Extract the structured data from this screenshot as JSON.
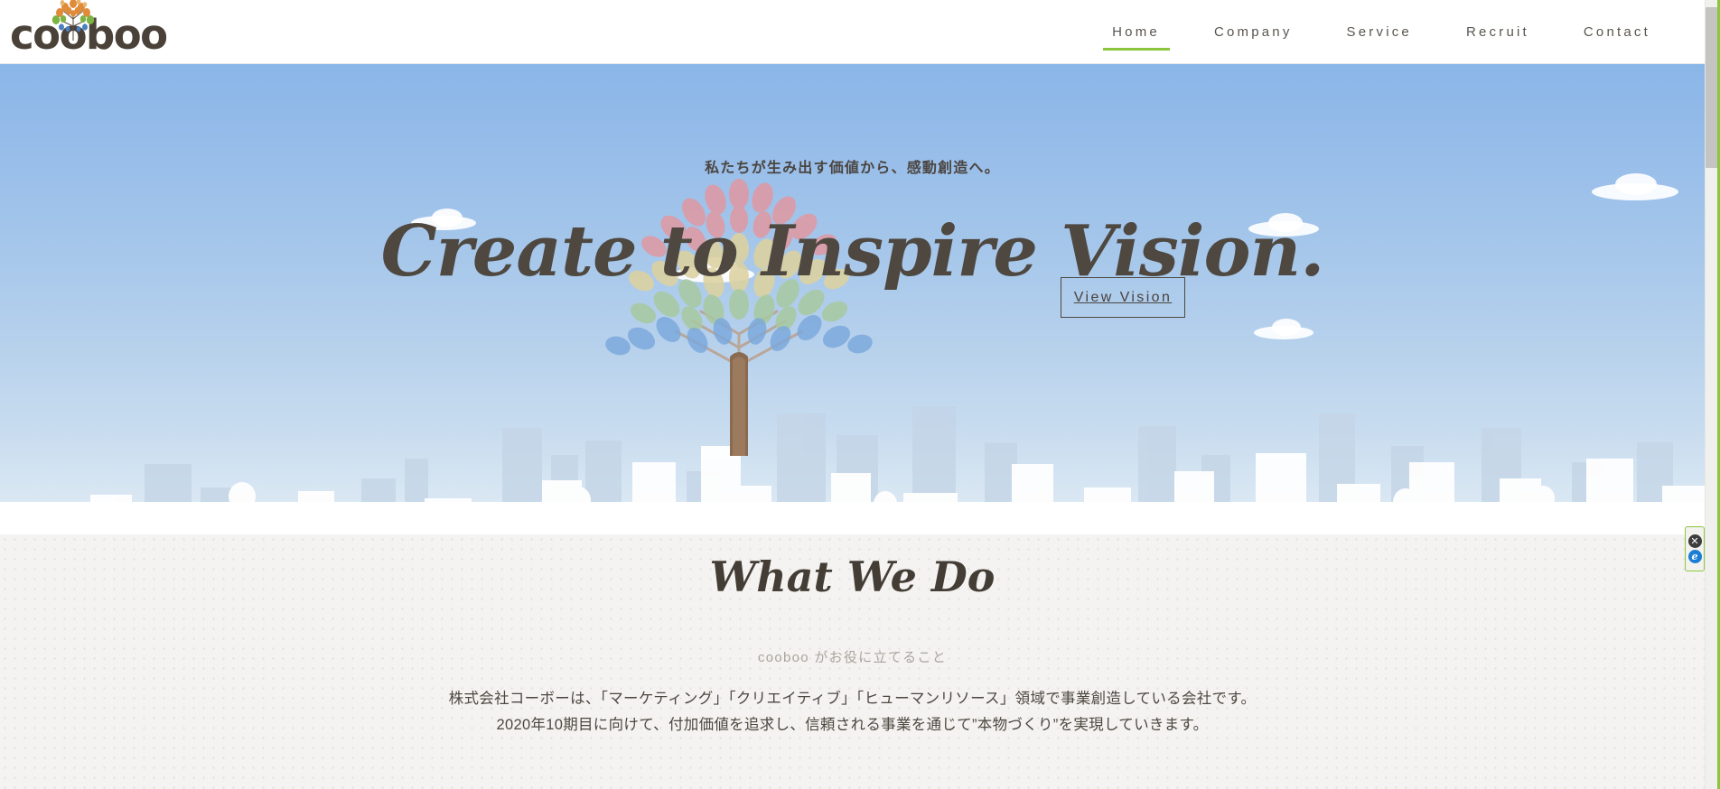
{
  "header": {
    "logo_text": "cooboo",
    "logo_icon": "tree-logo-icon",
    "nav": [
      {
        "label": "Home",
        "active": true
      },
      {
        "label": "Company",
        "active": false
      },
      {
        "label": "Service",
        "active": false
      },
      {
        "label": "Recruit",
        "active": false
      },
      {
        "label": "Contact",
        "active": false
      }
    ],
    "accent_color": "#8cc63f"
  },
  "hero": {
    "tagline": "私たちが生み出す価値から、感動創造へ。",
    "title": "Create to Inspire Vision.",
    "button_label": "View Vision",
    "illustration": "tree-city-illustration",
    "sky_top_color": "#8ab6e8",
    "sky_bottom_color": "#e4eef7",
    "title_color": "#4e4840"
  },
  "what_we_do": {
    "title": "What We Do",
    "subtitle": "cooboo がお役に立てること",
    "body_line_1": "株式会社コーボーは、「マーケティング」「クリエイティブ」「ヒューマンリソース」領域で事業創造している会社です。",
    "body_line_2": "2020年10期目に向けて、付加価値を追求し、信頼される事業を通じて”本物づくり”を実現していきます。",
    "background_color": "#f4f3f1"
  },
  "floating_widget": {
    "close_label": "✕",
    "browser_label": "e"
  }
}
